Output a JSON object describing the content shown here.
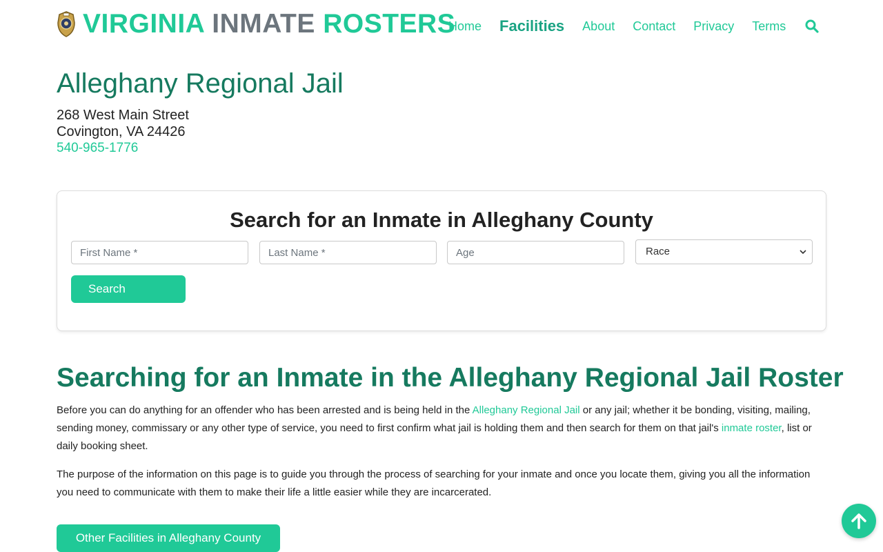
{
  "colors": {
    "accent": "#20c997",
    "heading": "#167a5f",
    "gray": "#6c757d"
  },
  "header": {
    "brand": {
      "word1": "VIRGINIA",
      "word2": "INMATE",
      "word3": "ROSTERS"
    },
    "nav": [
      {
        "label": "Home"
      },
      {
        "label": "Facilities"
      },
      {
        "label": "About"
      },
      {
        "label": "Contact"
      },
      {
        "label": "Privacy"
      },
      {
        "label": "Terms"
      }
    ],
    "search_icon": "search-icon",
    "logo_icon": "sheriff-badge-icon"
  },
  "facility": {
    "name": "Alleghany Regional Jail",
    "address_line1": "268 West Main Street",
    "address_line2": "Covington, VA 24426",
    "phone": "540-965-1776"
  },
  "search_form": {
    "title": "Search for an Inmate in Alleghany County",
    "first_name_placeholder": "First Name *",
    "last_name_placeholder": "Last Name *",
    "age_placeholder": "Age",
    "race_selected": "Race",
    "submit_label": "Search"
  },
  "article": {
    "heading": "Searching for an Inmate in the Alleghany Regional Jail Roster",
    "p1_a": "Before you can do anything for an offender who has been arrested and is being held in the ",
    "p1_link1": "Alleghany Regional Jail",
    "p1_b": " or any jail; whether it be bonding, visiting, mailing, sending money, commissary or any other type of service, you need to first confirm what jail is holding them and then search for them on that jail's ",
    "p1_link2": "inmate roster",
    "p1_c": ", list or daily booking sheet.",
    "p2": "The purpose of the information on this page is to guide you through the process of searching for your inmate and once you locate them, giving you all the information you need to communicate with them to make their life a little easier while they are incarcerated."
  },
  "other_facilities_button": "Other Facilities in Alleghany County",
  "scroll_top_icon": "arrow-up-icon"
}
